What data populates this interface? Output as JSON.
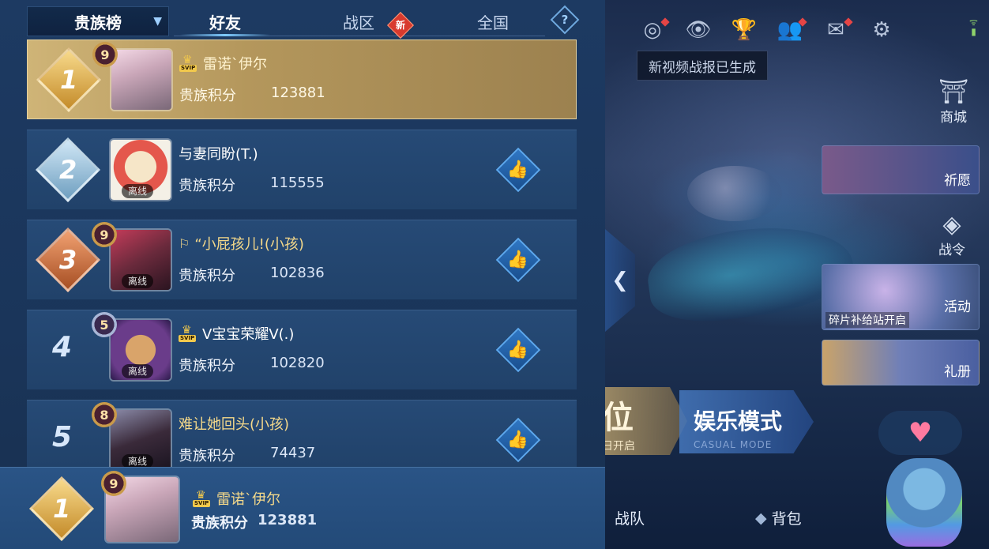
{
  "tabs": {
    "dropdown_label": "贵族榜",
    "friends": "好友",
    "zone": "战区",
    "zone_badge": "新",
    "national": "全国",
    "help": "?"
  },
  "rows": [
    {
      "rank": "1",
      "level": "9",
      "name": "雷诺`伊尔",
      "score_label": "贵族积分",
      "score": "123881",
      "svip": true,
      "offline": ""
    },
    {
      "rank": "2",
      "level": "",
      "name": "与妻同盼(T.)",
      "score_label": "贵族积分",
      "score": "115555",
      "svip": false,
      "offline": "离线"
    },
    {
      "rank": "3",
      "level": "9",
      "name": "“小屁孩儿!(小孩)",
      "score_label": "贵族积分",
      "score": "102836",
      "svip": false,
      "offline": "离线"
    },
    {
      "rank": "4",
      "level": "5",
      "name": "V宝宝荣耀V(.)",
      "score_label": "贵族积分",
      "score": "102820",
      "svip": true,
      "offline": "离线"
    },
    {
      "rank": "5",
      "level": "8",
      "name": "难让她回头(小孩)",
      "score_label": "贵族积分",
      "score": "74437",
      "svip": false,
      "offline": "离线"
    }
  ],
  "mine": {
    "rank": "1",
    "level": "9",
    "name": "雷诺`伊尔",
    "score_label": "贵族积分",
    "score": "123881"
  },
  "svip_tag": "SVIP",
  "tooltip": "新视频战报已生成",
  "side": {
    "shop": "商城",
    "wish": "祈愿",
    "battlepass": "战令",
    "activity": "活动",
    "activity_caption": "碎片补给站开启",
    "album": "礼册"
  },
  "modes": {
    "ranked_big": "位",
    "ranked_small": "日开启",
    "casual": "娱乐模式",
    "casual_sub": "CASUAL MODE"
  },
  "bottom_nav": {
    "team": "战队",
    "bag": "背包"
  },
  "icons": {
    "like": "thumbs-up-icon",
    "collapse": "chevron-left-icon"
  },
  "colors": {
    "gold_row": "#cfb477",
    "panel": "#1d3a62",
    "accent_blue": "#5da8ee"
  }
}
